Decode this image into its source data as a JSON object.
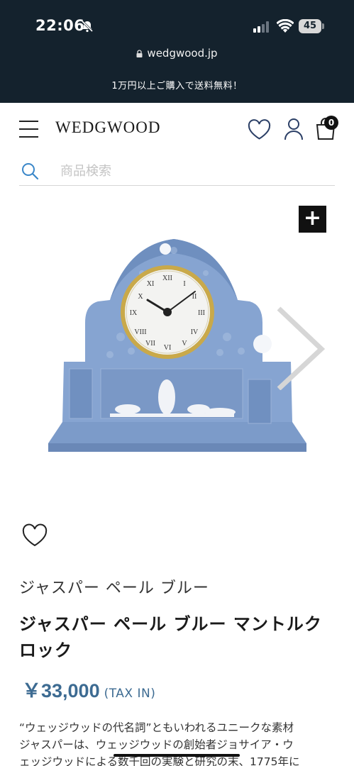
{
  "status_bar": {
    "time": "22:06",
    "battery": "45",
    "url": "wedgwood.jp"
  },
  "promo_banner": "1万円以上ご購入で送料無料！",
  "header": {
    "logo": "WEDGWOOD",
    "cart_count": "0"
  },
  "search": {
    "placeholder": "商品検索"
  },
  "product": {
    "series": "ジャスパー ペール ブルー",
    "name": "ジャスパー ペール ブルー マントルクロック",
    "price": "￥33,000",
    "tax_label": "(TAX IN)",
    "description_lines": [
      "“ウェッジウッドの代名詞”ともいわれるユニークな素材",
      "ジャスパーは、ウェッジウッドの創始者ジョサイア・ウ",
      "ェッジウッドによる数千回の実験と研究の末、1775年に"
    ]
  },
  "colors": {
    "chrome_bg": "#14222d",
    "price_accent": "#3d6b92",
    "jasper_blue": "#7c9bc9"
  }
}
